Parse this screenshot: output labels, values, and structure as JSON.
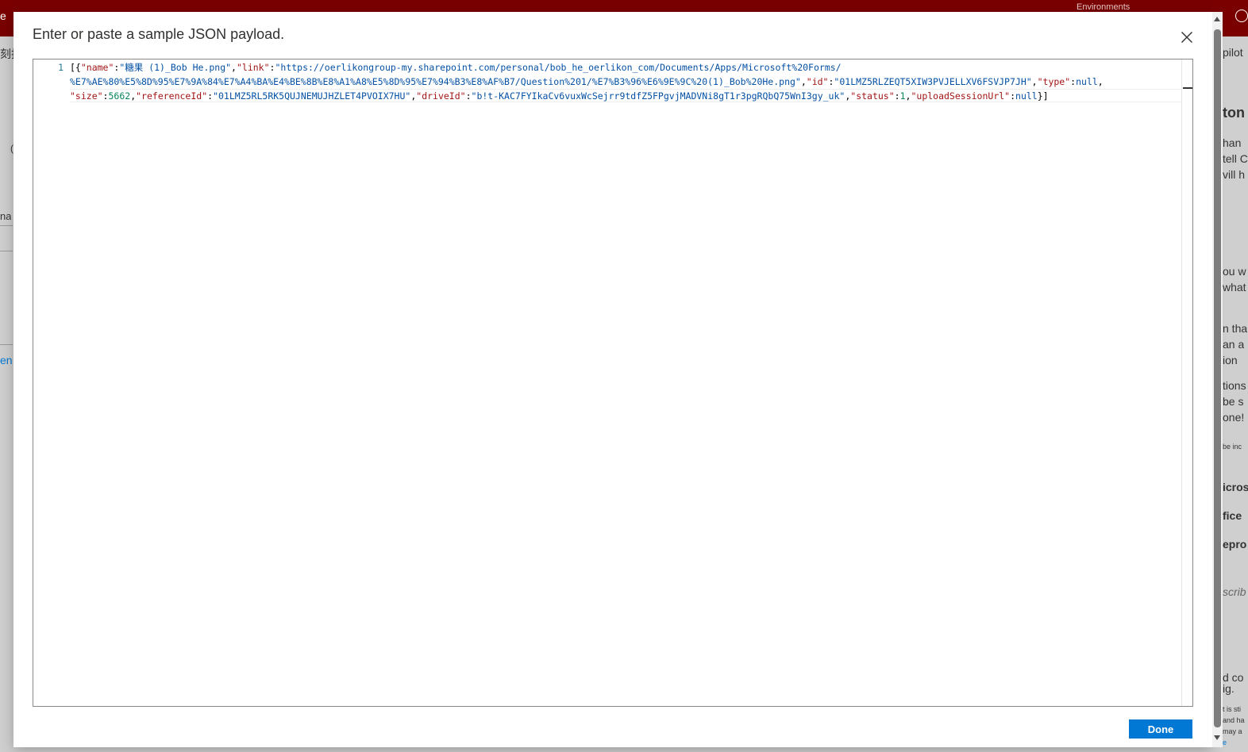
{
  "topbar": {
    "environments_label": "Environments",
    "left_fragment": "e"
  },
  "background": {
    "left_fragments": [
      "刻批",
      "(",
      "na",
      "en"
    ],
    "right_fragments": [
      "pilot",
      "ton",
      "han",
      "tell C",
      "vill h",
      "ou w",
      "what",
      "n tha",
      "an a",
      "ion",
      "tions",
      "be s",
      "one!",
      "be inc",
      "icros",
      "fice",
      "epro",
      "scrib",
      "d co",
      "ig.",
      "t is sti",
      "and ha",
      "may a",
      "e"
    ]
  },
  "dialog": {
    "title": "Enter or paste a sample JSON payload.",
    "close_label": "Close",
    "done_label": "Done"
  },
  "editor": {
    "line_numbers": [
      "1"
    ],
    "code_lines": [
      [
        {
          "t": "p",
          "v": "[{"
        },
        {
          "t": "k",
          "v": "\"name\""
        },
        {
          "t": "p",
          "v": ":"
        },
        {
          "t": "s",
          "v": "\"糖果 (1)_Bob He.png\""
        },
        {
          "t": "p",
          "v": ","
        },
        {
          "t": "k",
          "v": "\"link\""
        },
        {
          "t": "p",
          "v": ":"
        },
        {
          "t": "s",
          "v": "\"https://oerlikongroup-my.sharepoint.com/personal/bob_he_oerlikon_com/Documents/Apps/Microsoft%20Forms/"
        }
      ],
      [
        {
          "t": "s",
          "v": "%E7%AE%80%E5%8D%95%E7%9A%84%E7%A4%BA%E4%BE%8B%E8%A1%A8%E5%8D%95%E7%94%B3%E8%AF%B7/Question%201/%E7%B3%96%E6%9E%9C%20(1)_Bob%20He.png\""
        },
        {
          "t": "p",
          "v": ","
        },
        {
          "t": "k",
          "v": "\"id\""
        },
        {
          "t": "p",
          "v": ":"
        },
        {
          "t": "s",
          "v": "\"01LMZ5RLZEQT5XIW3PVJELLXV6FSVJP7JH\""
        },
        {
          "t": "p",
          "v": ","
        },
        {
          "t": "k",
          "v": "\"type\""
        },
        {
          "t": "p",
          "v": ":"
        },
        {
          "t": "b",
          "v": "null"
        },
        {
          "t": "p",
          "v": ","
        }
      ],
      [
        {
          "t": "k",
          "v": "\"size\""
        },
        {
          "t": "p",
          "v": ":"
        },
        {
          "t": "n",
          "v": "5662"
        },
        {
          "t": "p",
          "v": ","
        },
        {
          "t": "k",
          "v": "\"referenceId\""
        },
        {
          "t": "p",
          "v": ":"
        },
        {
          "t": "s",
          "v": "\"01LMZ5RL5RK5QUJNEMUJHZLET4PVOIX7HU\""
        },
        {
          "t": "p",
          "v": ","
        },
        {
          "t": "k",
          "v": "\"driveId\""
        },
        {
          "t": "p",
          "v": ":"
        },
        {
          "t": "s",
          "v": "\"b!t-KAC7FYIkaCv6vuxWcSejrr9tdfZ5FPgvjMADVNi8gT1r3pgRQbQ75WnI3gy_uk\""
        },
        {
          "t": "p",
          "v": ","
        },
        {
          "t": "k",
          "v": "\"status\""
        },
        {
          "t": "p",
          "v": ":"
        },
        {
          "t": "n",
          "v": "1"
        },
        {
          "t": "p",
          "v": ","
        },
        {
          "t": "k",
          "v": "\"uploadSessionUrl\""
        },
        {
          "t": "p",
          "v": ":"
        },
        {
          "t": "b",
          "v": "null"
        },
        {
          "t": "p",
          "v": "}]"
        }
      ]
    ]
  },
  "colors": {
    "topbar": "#7a0000",
    "primary_button": "#0078d4",
    "json_key": "#a31515",
    "json_string": "#0451a5",
    "json_number": "#098658",
    "line_number": "#237893"
  }
}
